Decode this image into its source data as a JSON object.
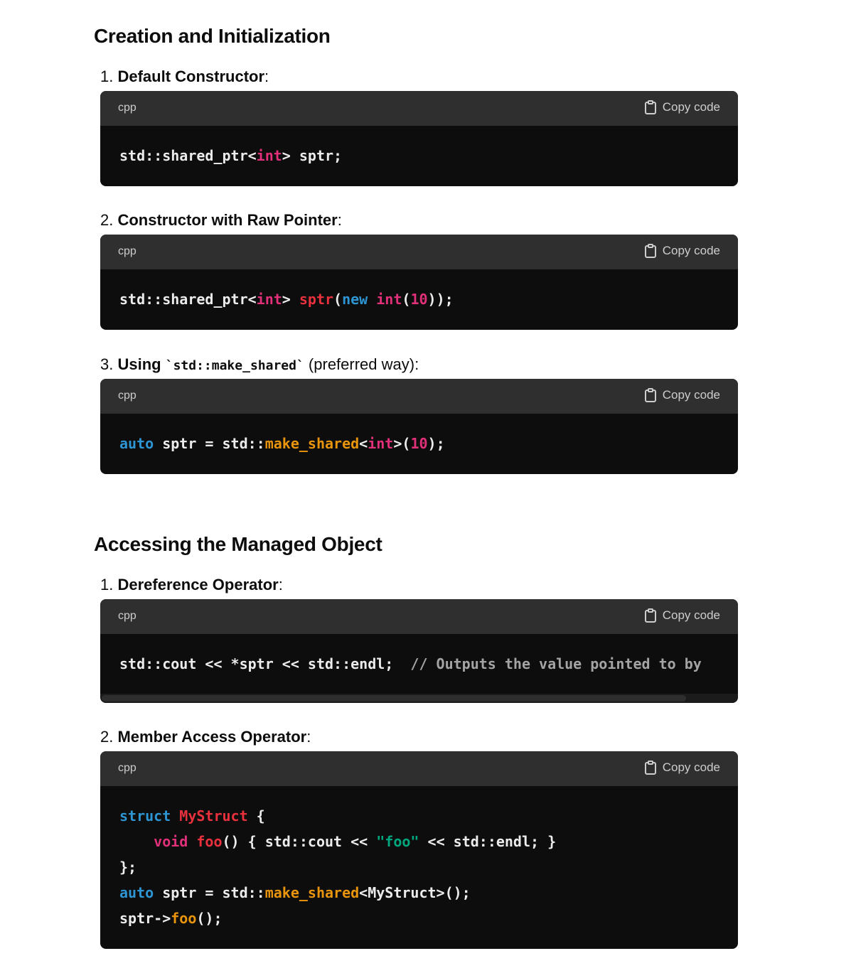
{
  "sections": [
    {
      "title": "Creation and Initialization",
      "items": [
        {
          "number": "1.",
          "name": "Default Constructor",
          "suffix": ":",
          "lang": "cpp",
          "copy_label": "Copy code",
          "code": "std::shared_ptr<int> sptr;"
        },
        {
          "number": "2.",
          "name": "Constructor with Raw Pointer",
          "suffix": ":",
          "lang": "cpp",
          "copy_label": "Copy code",
          "code": "std::shared_ptr<int> sptr(new int(10));"
        },
        {
          "number": "3.",
          "name": "Using",
          "inline_code": "`std::make_shared`",
          "suffix": " (preferred way):",
          "lang": "cpp",
          "copy_label": "Copy code",
          "code": "auto sptr = std::make_shared<int>(10);"
        }
      ]
    },
    {
      "title": "Accessing the Managed Object",
      "items": [
        {
          "number": "1.",
          "name": "Dereference Operator",
          "suffix": ":",
          "lang": "cpp",
          "copy_label": "Copy code",
          "code": "std::cout << *sptr << std::endl;  // Outputs the value pointed to by"
        },
        {
          "number": "2.",
          "name": "Member Access Operator",
          "suffix": ":",
          "lang": "cpp",
          "copy_label": "Copy code",
          "code_lines": [
            "struct MyStruct {",
            "    void foo() { std::cout << \"foo\" << std::endl; }",
            "};",
            "auto sptr = std::make_shared<MyStruct>();",
            "sptr->foo();"
          ]
        }
      ]
    }
  ],
  "colors": {
    "keyword_blue": "#2e95d3",
    "type_pink": "#df3079",
    "name_red": "#e9313e",
    "function_orange": "#e9950c",
    "string_green": "#00a67d",
    "comment_gray": "#a4a4a4",
    "code_bg": "#0d0d0d",
    "header_bg": "#2f2f2f"
  },
  "icons": {
    "copy": "clipboard-icon"
  }
}
